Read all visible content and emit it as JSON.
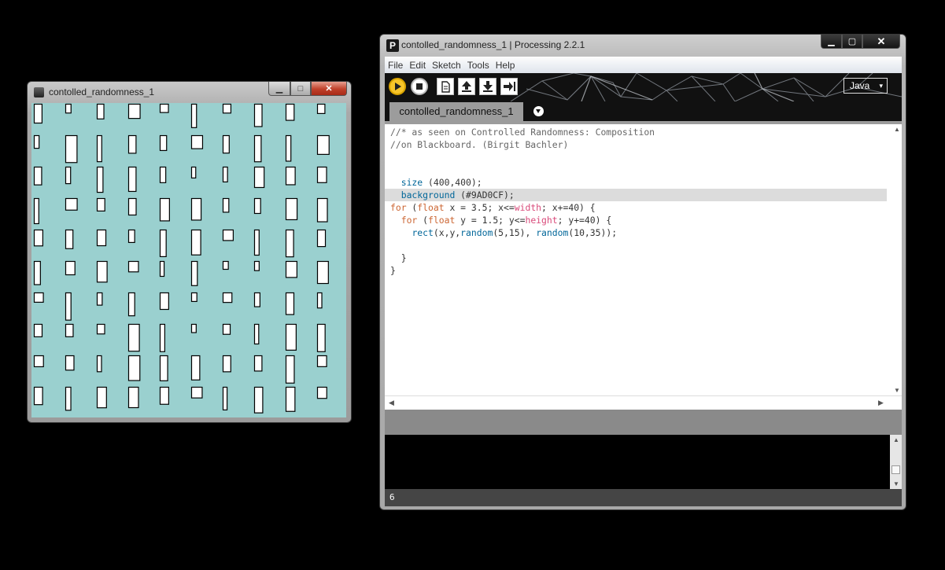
{
  "sketch_window": {
    "title": "contolled_randomness_1",
    "background_color": "#9AD0CF",
    "window_buttons": {
      "minimize": "▁",
      "maximize": "□",
      "close": "✕"
    }
  },
  "ide_window": {
    "title": "contolled_randomness_1 | Processing 2.2.1",
    "app_icon_letter": "P",
    "window_buttons": {
      "minimize": "▁",
      "maximize": "▢",
      "close": "✕"
    },
    "menu": [
      "File",
      "Edit",
      "Sketch",
      "Tools",
      "Help"
    ],
    "toolbar": {
      "buttons": [
        "run-icon",
        "stop-icon",
        "new-icon",
        "open-icon",
        "save-icon",
        "export-icon"
      ],
      "mode": "Java"
    },
    "tab": {
      "label": "contolled_randomness_1"
    },
    "code": [
      [
        [
          "c",
          "//* as seen on Controlled Randomness: Composition"
        ]
      ],
      [
        [
          "c",
          "//on Blackboard. (Birgit Bachler)"
        ]
      ],
      [],
      [],
      [
        [
          "t",
          "  "
        ],
        [
          "f",
          "size"
        ],
        [
          "t",
          " (400,400);"
        ]
      ],
      [
        [
          "t",
          "  "
        ],
        [
          "f",
          "background"
        ],
        [
          "t",
          " (#9AD0CF);"
        ]
      ],
      [
        [
          "k",
          "for"
        ],
        [
          "t",
          " ("
        ],
        [
          "k",
          "float"
        ],
        [
          "t",
          " x = 3.5; x<="
        ],
        [
          "v",
          "width"
        ],
        [
          "t",
          "; x+=40) {"
        ]
      ],
      [
        [
          "t",
          "  "
        ],
        [
          "k",
          "for"
        ],
        [
          "t",
          " ("
        ],
        [
          "k",
          "float"
        ],
        [
          "t",
          " y = 1.5; y<="
        ],
        [
          "v",
          "height"
        ],
        [
          "t",
          "; y+=40) {"
        ]
      ],
      [
        [
          "t",
          "    "
        ],
        [
          "f",
          "rect"
        ],
        [
          "t",
          "(x,y,"
        ],
        [
          "f",
          "random"
        ],
        [
          "t",
          "(5,15), "
        ],
        [
          "f",
          "random"
        ],
        [
          "t",
          "(10,35));"
        ]
      ],
      [],
      [
        [
          "t",
          "  }"
        ]
      ],
      [
        [
          "t",
          "}"
        ]
      ]
    ],
    "current_line_index": 5,
    "status_line_number": "6"
  }
}
